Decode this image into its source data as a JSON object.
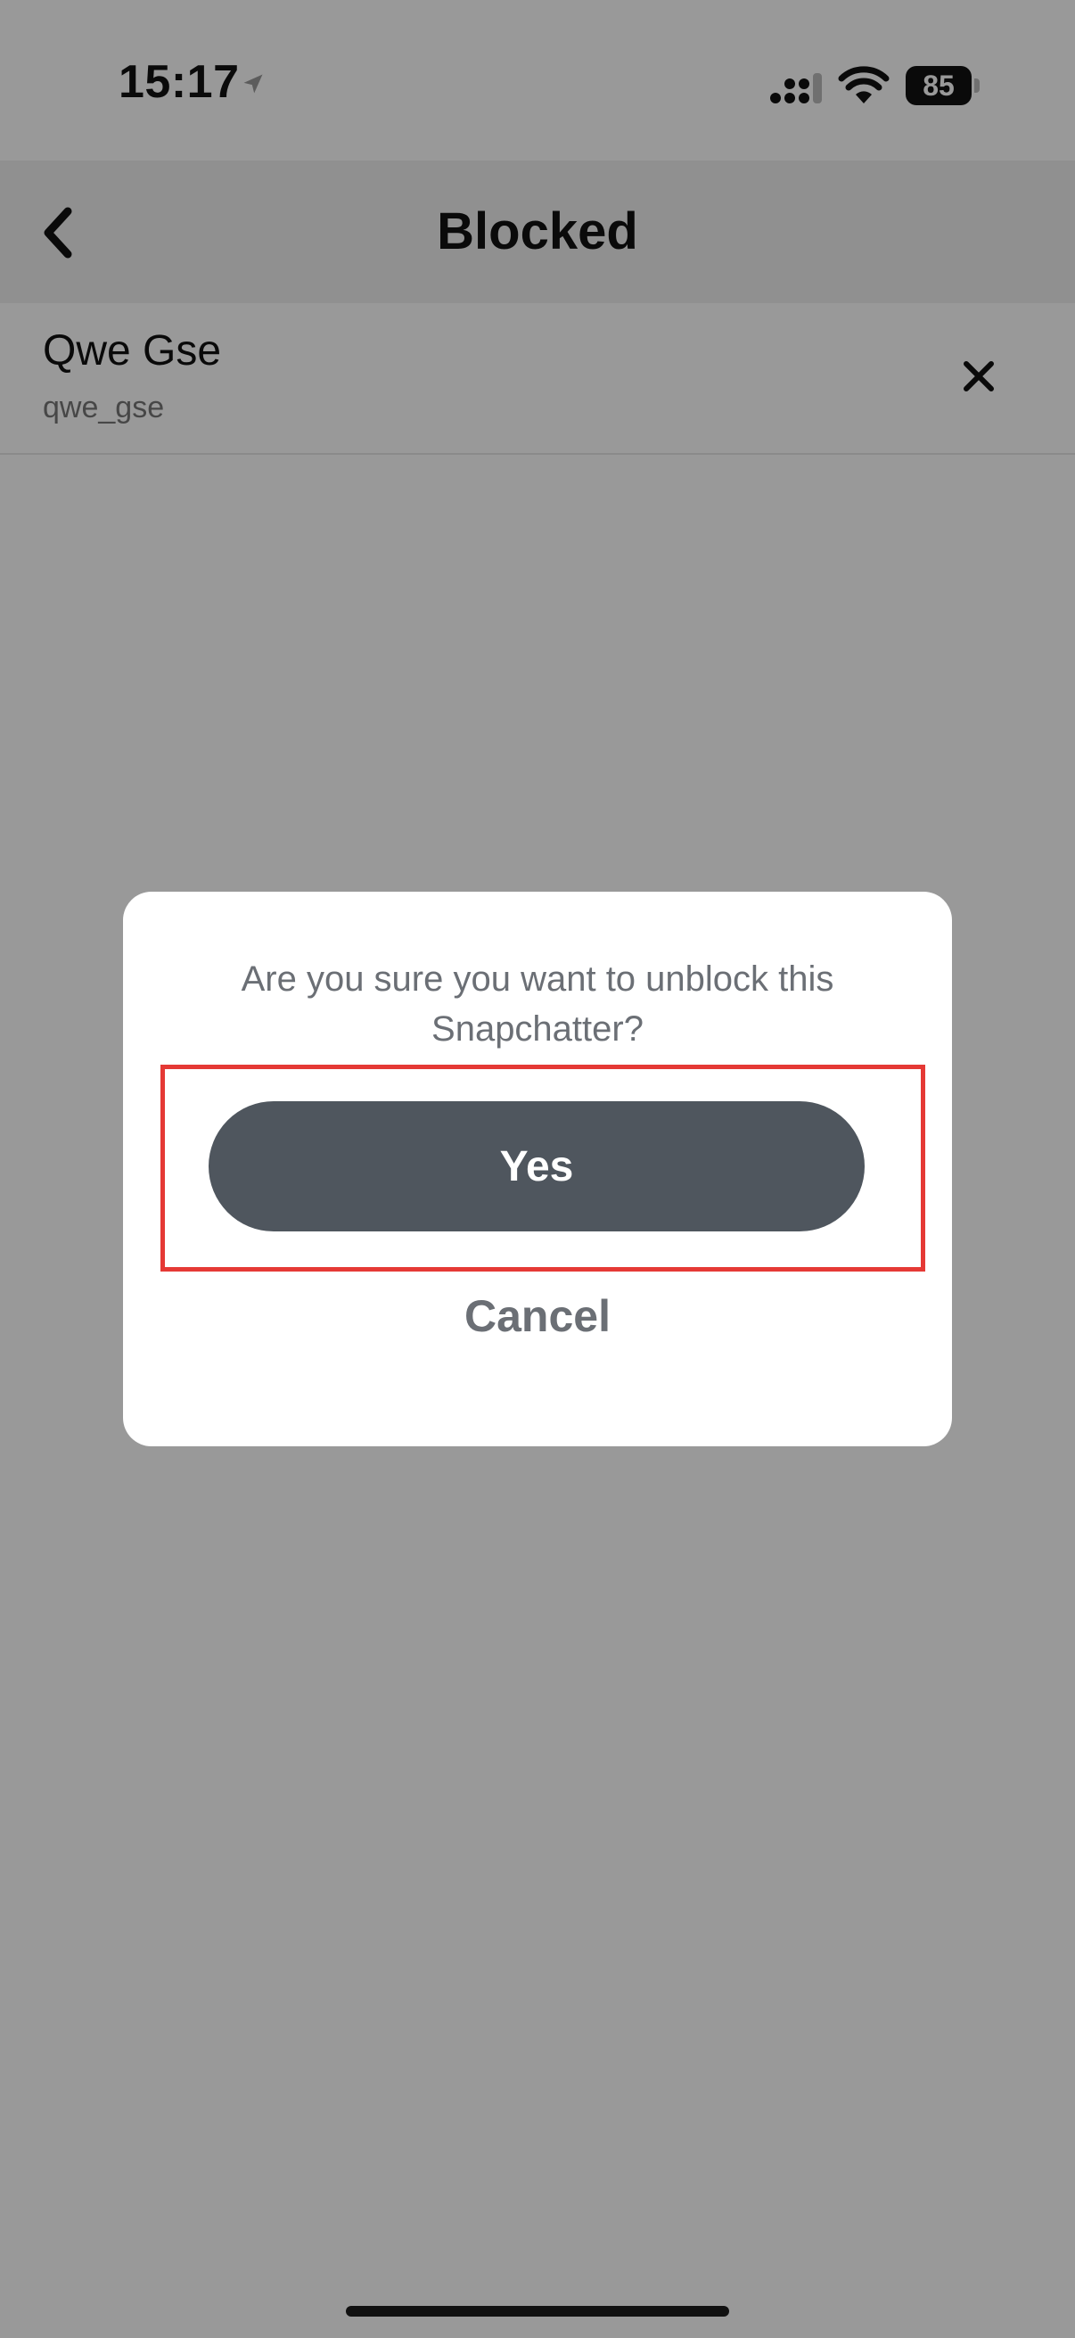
{
  "status_bar": {
    "time": "15:17",
    "battery": "85"
  },
  "nav": {
    "title": "Blocked"
  },
  "blocked_list": [
    {
      "name": "Qwe Gse",
      "username": "qwe_gse"
    }
  ],
  "dialog": {
    "message": "Are you sure you want to unblock this Snapchatter?",
    "confirm_label": "Yes",
    "cancel_label": "Cancel"
  },
  "colors": {
    "overlay": "#000000",
    "button_bg": "#4f565e",
    "highlight": "#e53935"
  }
}
